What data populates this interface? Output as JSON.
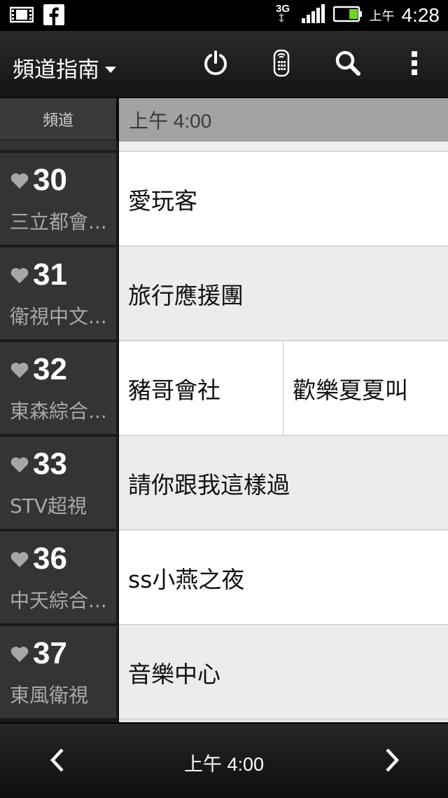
{
  "statusbar": {
    "period": "上午",
    "time": "4:28",
    "network": "3G"
  },
  "actionbar": {
    "title": "頻道指南"
  },
  "header": {
    "channel_label": "頻道",
    "time_label": "上午 4:00"
  },
  "channels": [
    {
      "number": "30",
      "name": "三立都會..."
    },
    {
      "number": "31",
      "name": "衛視中文..."
    },
    {
      "number": "32",
      "name": "東森綜合..."
    },
    {
      "number": "33",
      "name": "STV超視"
    },
    {
      "number": "36",
      "name": "中天綜合..."
    },
    {
      "number": "37",
      "name": "東風衛視"
    }
  ],
  "programs": [
    [
      {
        "title": "愛玩客"
      }
    ],
    [
      {
        "title": "旅行應援團"
      }
    ],
    [
      {
        "title": "豬哥會社"
      },
      {
        "title": "歡樂夏夏叫"
      }
    ],
    [
      {
        "title": "請你跟我這樣過"
      }
    ],
    [
      {
        "title": "ss小燕之夜"
      }
    ],
    [
      {
        "title": "音樂中心"
      }
    ]
  ],
  "bottombar": {
    "time_label": "上午 4:00"
  }
}
